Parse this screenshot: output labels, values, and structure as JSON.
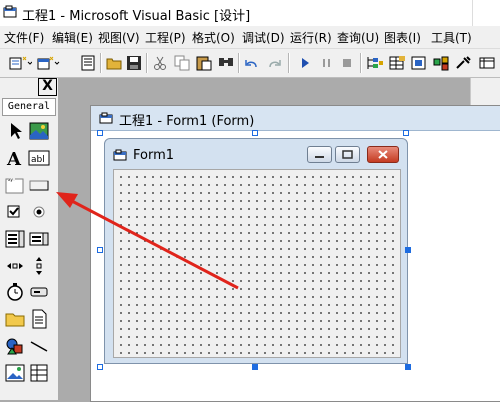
{
  "app": {
    "title": "工程1 - Microsoft Visual Basic [设计]"
  },
  "menubar": {
    "items": [
      "文件(F)",
      "编辑(E)",
      "视图(V)",
      "工程(P)",
      "格式(O)",
      "调试(D)",
      "运行(R)",
      "查询(U)",
      "图表(I)",
      "工具(T)"
    ]
  },
  "toolbox": {
    "close_label": "X",
    "tab_label": "General",
    "tools": [
      {
        "name": "pointer-tool-icon"
      },
      {
        "name": "picturebox-tool-icon"
      },
      {
        "name": "label-tool-icon",
        "glyph": "A"
      },
      {
        "name": "textbox-tool-icon",
        "glyph": "ab|"
      },
      {
        "name": "frame-tool-icon"
      },
      {
        "name": "commandbutton-tool-icon"
      },
      {
        "name": "checkbox-tool-icon"
      },
      {
        "name": "optionbutton-tool-icon"
      },
      {
        "name": "combobox-tool-icon"
      },
      {
        "name": "listbox-tool-icon"
      },
      {
        "name": "hscrollbar-tool-icon"
      },
      {
        "name": "vscrollbar-tool-icon"
      },
      {
        "name": "timer-tool-icon"
      },
      {
        "name": "drivelistbox-tool-icon"
      },
      {
        "name": "dirlistbox-tool-icon"
      },
      {
        "name": "filelistbox-tool-icon"
      },
      {
        "name": "shape-tool-icon"
      },
      {
        "name": "line-tool-icon"
      },
      {
        "name": "image-tool-icon"
      },
      {
        "name": "data-tool-icon"
      }
    ]
  },
  "designer": {
    "window_title": "工程1 - Form1 (Form)"
  },
  "form": {
    "caption": "Form1"
  },
  "colors": {
    "arrow": "#e0241b",
    "selection_handle": "#1e6ce0",
    "form_title_bg": "#d3e1f0"
  }
}
